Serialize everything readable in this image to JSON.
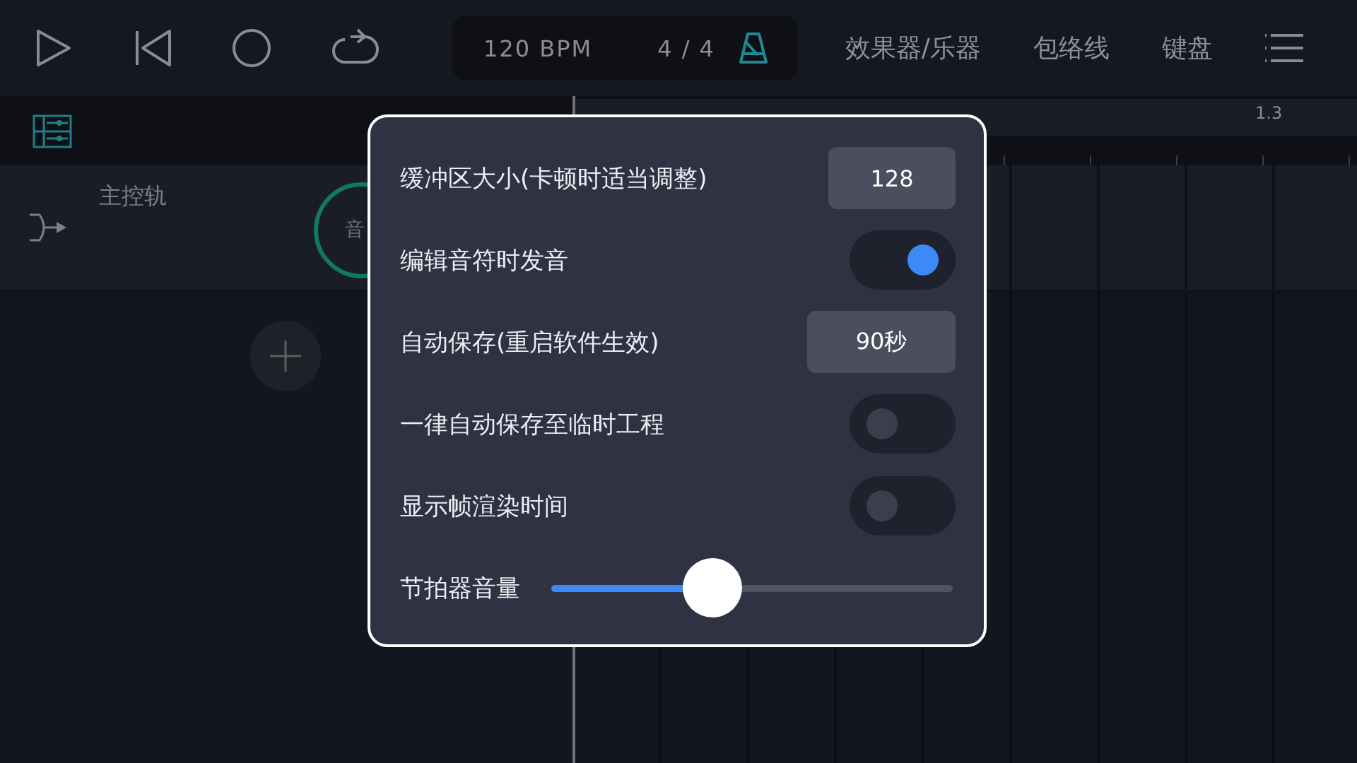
{
  "tempo": {
    "bpm": "120 BPM",
    "time_signature": "4 / 4"
  },
  "nav": [
    "效果器/乐器",
    "包络线",
    "键盘"
  ],
  "ruler": {
    "labels": [
      "1.3"
    ]
  },
  "track": {
    "name": "主控轨",
    "knob_label": "音"
  },
  "settings": {
    "rows": [
      {
        "kind": "value",
        "label": "缓冲区大小(卡顿时适当调整)",
        "value": "128"
      },
      {
        "kind": "toggle",
        "label": "编辑音符时发音",
        "on": true
      },
      {
        "kind": "value",
        "label": "自动保存(重启软件生效)",
        "value": "90秒"
      },
      {
        "kind": "toggle",
        "label": "一律自动保存至临时工程",
        "on": false
      },
      {
        "kind": "toggle",
        "label": "显示帧渲染时间",
        "on": false
      },
      {
        "kind": "slider",
        "label": "节拍器音量",
        "level": 0.4
      }
    ]
  }
}
